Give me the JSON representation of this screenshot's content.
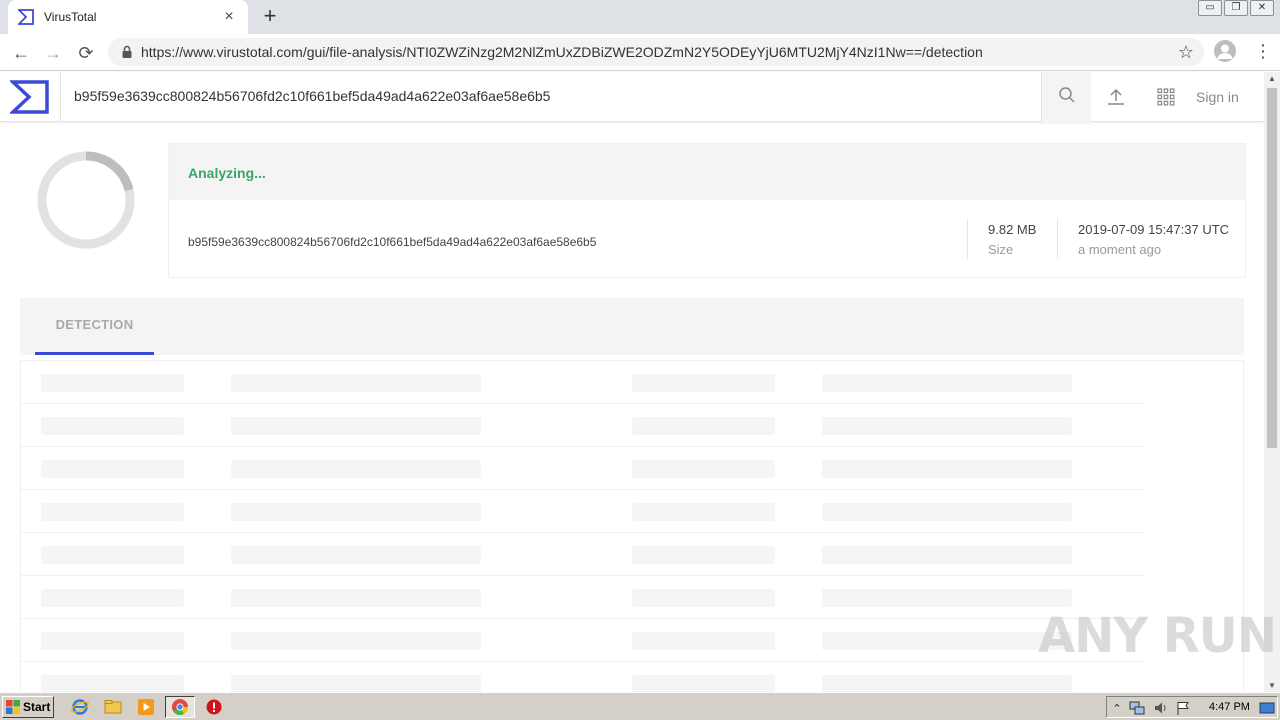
{
  "browser": {
    "tab_title": "VirusTotal",
    "tab_close": "×",
    "new_tab": "+",
    "url": "https://www.virustotal.com/gui/file-analysis/NTI0ZWZiNzg2M2NlZmUxZDBiZWE2ODZmN2Y5ODEyYjU6MTU2MjY4NzI1Nw==/detection",
    "back": "←",
    "forward": "→",
    "reload": "⟳",
    "star": "☆",
    "menu": "⋮",
    "win_minimize": "▭",
    "win_restore": "❐",
    "win_close": "✕"
  },
  "vt_header": {
    "search_value": "b95f59e3639cc800824b56706fd2c10f661bef5da49ad4a622e03af6ae58e6b5",
    "sign_in": "Sign in"
  },
  "summary": {
    "status": "Analyzing...",
    "hash": "b95f59e3639cc800824b56706fd2c10f661bef5da49ad4a622e03af6ae58e6b5",
    "size_value": "9.82 MB",
    "size_label": "Size",
    "date_value": "2019-07-09 15:47:37 UTC",
    "date_relative": "a moment ago"
  },
  "tabs": {
    "detection": "DETECTION"
  },
  "watermark": "ANY RUN",
  "taskbar": {
    "start": "Start",
    "clock": "4:47 PM",
    "tray_up": "⌃"
  },
  "colors": {
    "vt_blue": "#3c4bd6",
    "analyzing_green": "#3aa56b"
  }
}
